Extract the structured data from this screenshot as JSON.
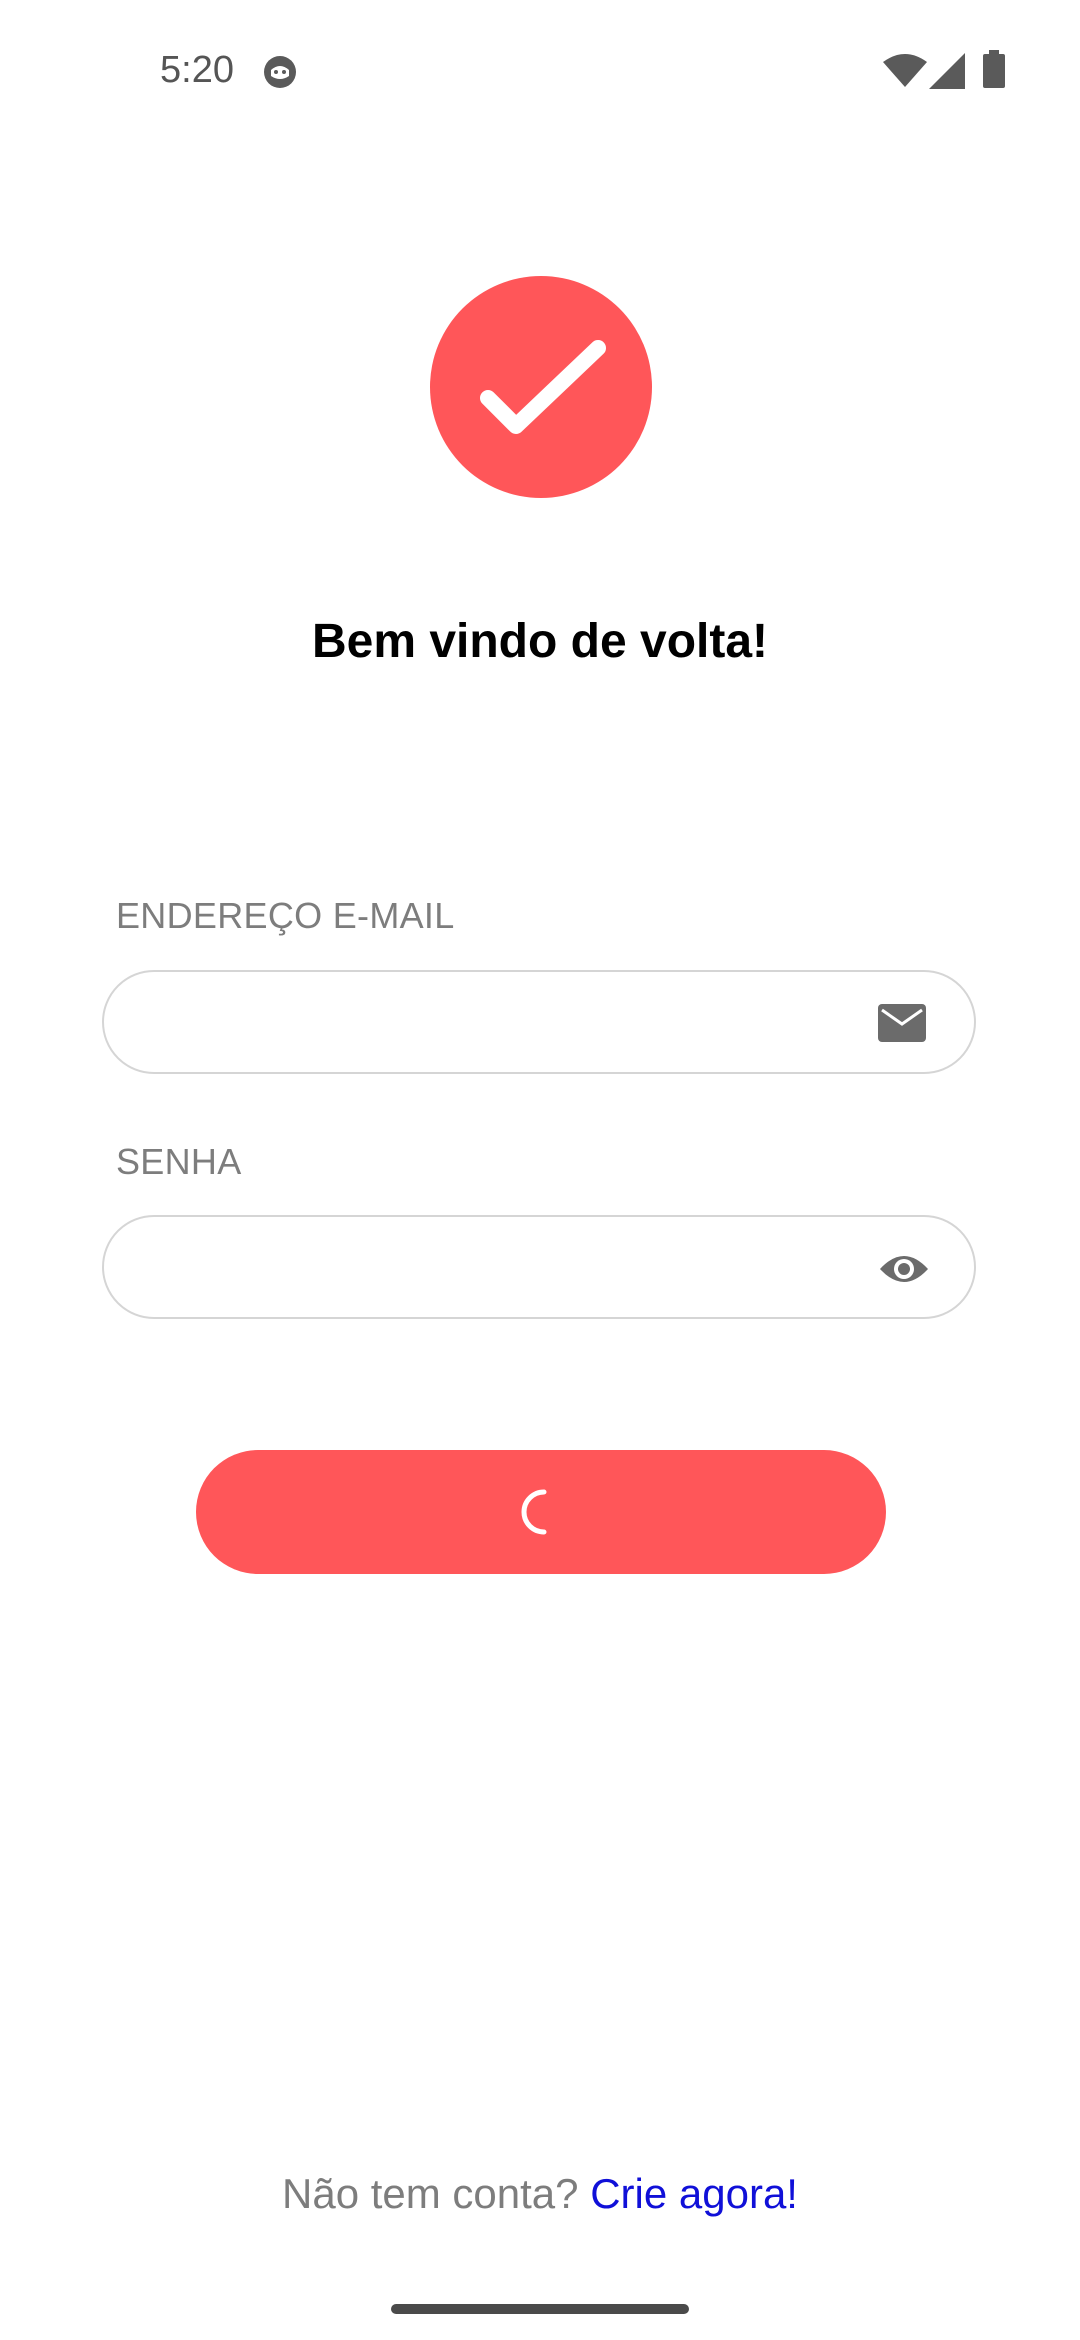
{
  "status_bar": {
    "time": "5:20",
    "icons": [
      "app-notification-icon",
      "wifi-icon",
      "signal-icon",
      "battery-icon"
    ]
  },
  "logo": {
    "icon": "checkmark-icon",
    "color": "#ff5659"
  },
  "welcome": {
    "title": "Bem vindo de volta!"
  },
  "form": {
    "email": {
      "label": "ENDEREÇO E-MAIL",
      "value": "",
      "icon": "mail-icon"
    },
    "password": {
      "label": "SENHA",
      "value": "",
      "icon": "eye-icon"
    },
    "submit": {
      "state": "loading",
      "icon": "spinner-icon",
      "color": "#ff5659"
    }
  },
  "footer": {
    "prompt": "Não tem conta?",
    "link": "Crie agora!",
    "link_color": "#1010d8"
  }
}
